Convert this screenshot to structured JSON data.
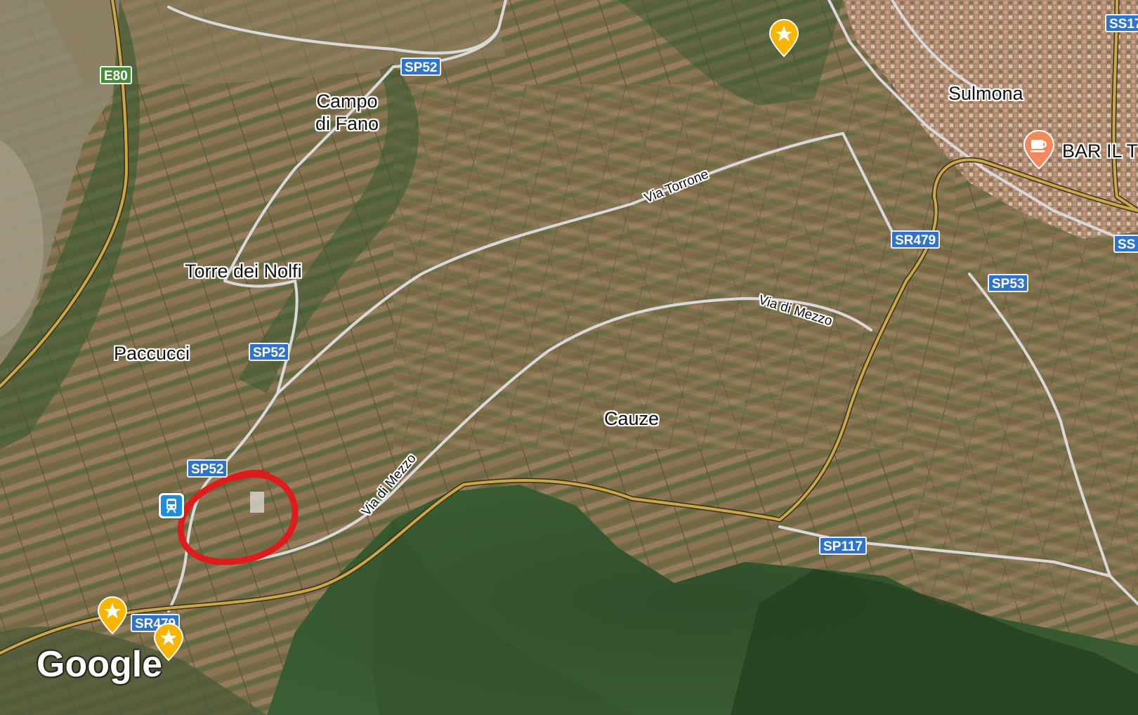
{
  "map": {
    "provider_logo": "Google",
    "place_labels": {
      "campo_di_fano_line1": "Campo",
      "campo_di_fano_line2": "di Fano",
      "torre_dei_nolfi": "Torre dei Nolfi",
      "paccucci": "Paccucci",
      "sulmona": "Sulmona",
      "cauze": "Cauze",
      "bar": "BAR IL T"
    },
    "road_labels": {
      "via_torrone": "Via Torrone",
      "via_di_mezzo_east": "Via di Mezzo",
      "via_di_mezzo_west": "Via di Mezzo"
    },
    "shields": {
      "e80": "E80",
      "sp52_top": "SP52",
      "sp52_mid": "SP52",
      "sp52_low": "SP52",
      "sr479_east": "SR479",
      "sr479_west": "SR479",
      "sp53": "SP53",
      "sp117": "SP117",
      "ss17_top": "SS17",
      "ss_right": "SS"
    },
    "icons": [
      "star-pin-icon",
      "train-station-icon",
      "cafe-pin-icon"
    ],
    "colors": {
      "shield_blue": "#2f74c9",
      "shield_green": "#4a8b3a",
      "highway_gold": "#c9a84a",
      "minor_road": "#d8d8d8",
      "annotation_circle": "#e01b1b",
      "star_pin": "#f7b500",
      "cafe_pin": "#f08a5d"
    }
  }
}
